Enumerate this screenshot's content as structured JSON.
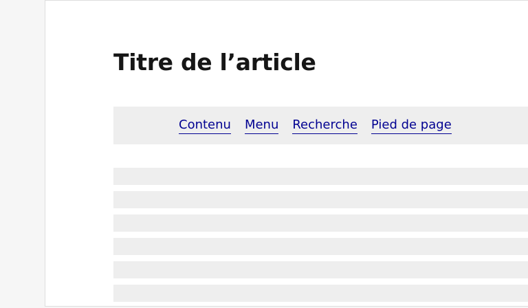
{
  "article": {
    "title": "Titre de l’article"
  },
  "skiplinks": {
    "items": [
      {
        "label": "Contenu"
      },
      {
        "label": "Menu"
      },
      {
        "label": "Recherche"
      },
      {
        "label": "Pied de page"
      }
    ]
  },
  "colors": {
    "link": "#000091",
    "bar_background": "#eeeeee",
    "page_background": "#ffffff",
    "outer_background": "#f6f6f6",
    "title": "#161616"
  }
}
